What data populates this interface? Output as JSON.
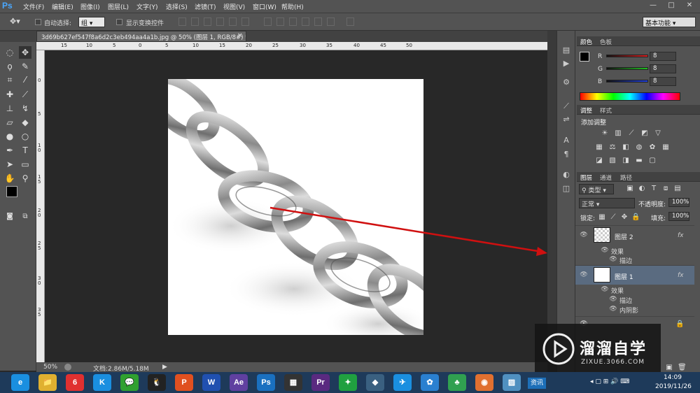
{
  "app": {
    "logo": "Ps"
  },
  "menu": [
    "文件(F)",
    "编辑(E)",
    "图像(I)",
    "图层(L)",
    "文字(Y)",
    "选择(S)",
    "滤镜(T)",
    "视图(V)",
    "窗口(W)",
    "帮助(H)"
  ],
  "window_controls": {
    "minimize": "—",
    "restore": "□",
    "close": "✕"
  },
  "options": {
    "auto_select_label": "自动选择:",
    "auto_select_value": "组",
    "show_transform_label": "显示变换控件",
    "workspace": "基本功能"
  },
  "document": {
    "tab_title": "3d69b627ef547f8a6d2c3eb494aa4a1b.jpg @ 50% (图层 1, RGB/8#) *",
    "tab_close": "×"
  },
  "rulers": {
    "h_ticks": [
      "15",
      "10",
      "5",
      "0",
      "5",
      "10",
      "15",
      "20",
      "25",
      "30",
      "35",
      "40",
      "45",
      "50"
    ],
    "v_ticks": [
      "0",
      "5",
      "1 0",
      "1 5",
      "2 0",
      "2 5",
      "3 0",
      "3 5"
    ]
  },
  "status": {
    "zoom": "50%",
    "doc_info": "文档:2.86M/5.18M"
  },
  "color_panel": {
    "tabs": [
      "颜色",
      "色板"
    ],
    "channels": [
      {
        "label": "R",
        "value": "8"
      },
      {
        "label": "G",
        "value": "8"
      },
      {
        "label": "B",
        "value": "8"
      }
    ],
    "colors": {
      "R": "#e02020",
      "G": "#20c020",
      "B": "#2040e0"
    }
  },
  "adjust_panel": {
    "tabs": [
      "调整",
      "样式"
    ],
    "title": "添加调整"
  },
  "layers_panel": {
    "tabs": [
      "图层",
      "通道",
      "路径"
    ],
    "filter": "类型",
    "blend": "正常",
    "opacity_label": "不透明度:",
    "opacity": "100%",
    "lock_label": "锁定:",
    "fill_label": "填充:",
    "fill": "100%",
    "layers": [
      {
        "name": "图层 2",
        "fx": "fx",
        "effects_label": "效果",
        "effects": [
          "描边"
        ]
      },
      {
        "name": "图层 1",
        "fx": "fx",
        "effects_label": "效果",
        "effects": [
          "描边",
          "内阴影"
        ]
      }
    ]
  },
  "taskbar": {
    "time": "14:09",
    "date": "2019/11/26",
    "label": "资讯",
    "apps": [
      "e",
      "📁",
      "6",
      "K",
      "💬",
      "🐧",
      "P",
      "W",
      "Ae",
      "Ps",
      "▦",
      "Pr",
      "✦",
      "◆",
      "✈",
      "✿",
      "♣",
      "◉",
      "▨"
    ]
  },
  "watermark": {
    "title": "溜溜自学",
    "url": "ZIXUE.3066.COM"
  }
}
